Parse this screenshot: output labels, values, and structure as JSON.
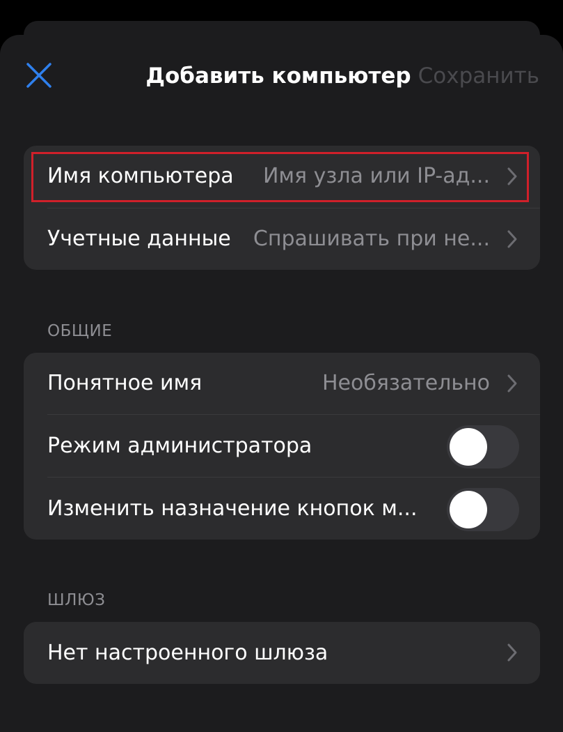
{
  "header": {
    "title": "Добавить компьютер",
    "save_label": "Сохранить",
    "close_icon": "close-icon",
    "accent_color": "#2f80ed"
  },
  "connection": {
    "pc_name_label": "Имя компьютера",
    "pc_name_placeholder": "Имя узла или IP-ад...",
    "credentials_label": "Учетные данные",
    "credentials_value": "Спрашивать при не..."
  },
  "general": {
    "header": "ОБЩИЕ",
    "friendly_name_label": "Понятное имя",
    "friendly_name_value": "Необязательно",
    "admin_mode_label": "Режим администратора",
    "admin_mode_on": false,
    "swap_buttons_label": "Изменить назначение кнопок м...",
    "swap_buttons_on": false
  },
  "gateway": {
    "header": "ШЛЮЗ",
    "value": "Нет настроенного шлюза"
  },
  "highlight_color": "#d0202a"
}
